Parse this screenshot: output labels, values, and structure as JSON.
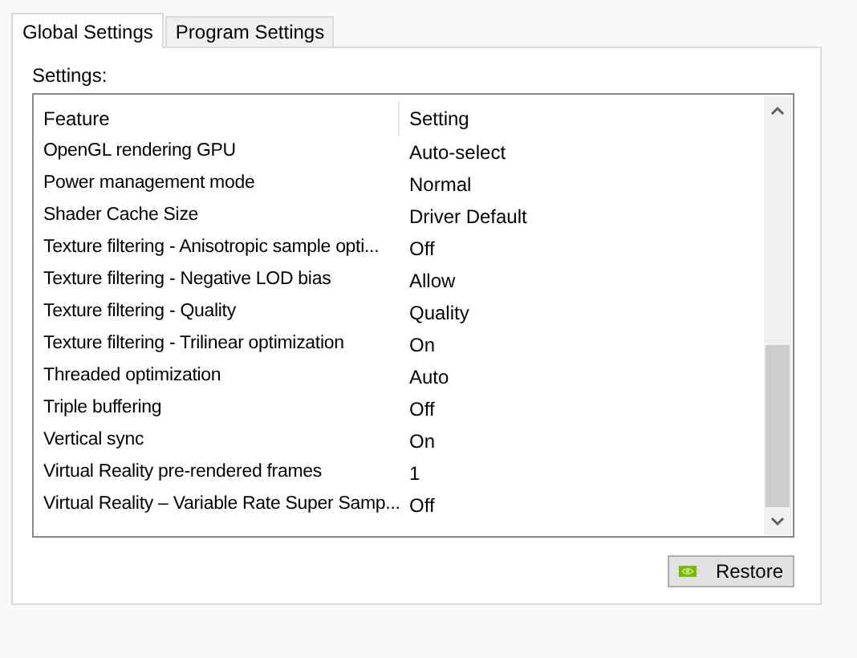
{
  "tabs": [
    {
      "label": "Global Settings",
      "selected": true
    },
    {
      "label": "Program Settings",
      "selected": false
    }
  ],
  "settings_label": "Settings:",
  "table": {
    "columns": [
      "Feature",
      "Setting"
    ],
    "rows": [
      [
        "OpenGL rendering GPU",
        "Auto-select"
      ],
      [
        "Power management mode",
        "Normal"
      ],
      [
        "Shader Cache Size",
        "Driver Default"
      ],
      [
        "Texture filtering - Anisotropic sample opti...",
        "Off"
      ],
      [
        "Texture filtering - Negative LOD bias",
        "Allow"
      ],
      [
        "Texture filtering - Quality",
        "Quality"
      ],
      [
        "Texture filtering - Trilinear optimization",
        "On"
      ],
      [
        "Threaded optimization",
        "Auto"
      ],
      [
        "Triple buffering",
        "Off"
      ],
      [
        "Vertical sync",
        "On"
      ],
      [
        "Virtual Reality pre-rendered frames",
        "1"
      ],
      [
        "Virtual Reality – Variable Rate Super Samp...",
        "Off"
      ]
    ]
  },
  "restore_button": "Restore"
}
